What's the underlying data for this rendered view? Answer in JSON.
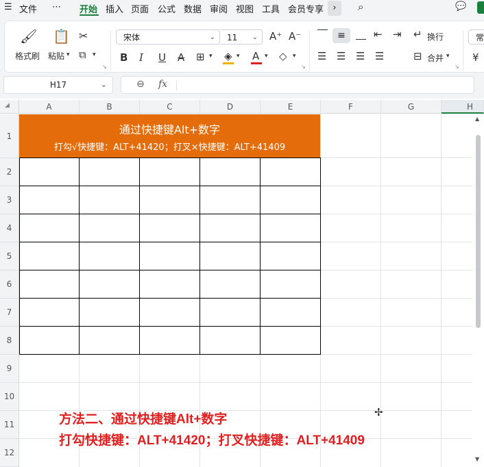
{
  "menubar": {
    "items": [
      {
        "label": "文件"
      },
      {
        "label": "⋯"
      },
      {
        "label": "开始"
      },
      {
        "label": "插入"
      },
      {
        "label": "页面"
      },
      {
        "label": "公式"
      },
      {
        "label": "数据"
      },
      {
        "label": "审阅"
      },
      {
        "label": "视图"
      },
      {
        "label": "工具"
      },
      {
        "label": "会员专享"
      }
    ],
    "active": "开始"
  },
  "ribbon": {
    "format_painter": "格式刷",
    "paste": "粘贴",
    "font_name": "宋体",
    "font_size": "11",
    "wrap": "换行",
    "merge": "合并",
    "cut_off": "常"
  },
  "formula_bar": {
    "cell_ref": "H17",
    "fx": "fx",
    "value": ""
  },
  "sheet": {
    "columns": [
      "A",
      "B",
      "C",
      "D",
      "E",
      "F",
      "G",
      "H"
    ],
    "rows": [
      "1",
      "2",
      "3",
      "4",
      "5",
      "6",
      "7",
      "8",
      "9",
      "10",
      "11",
      "12"
    ],
    "banner_title": "通过快捷键Alt+数字",
    "banner_subtitle": "打勾√快捷键：ALT+41420；打叉×快捷键：ALT+41409",
    "note_line1": "方法二、通过快捷键Alt+数字",
    "note_line2": "打勾快捷键：ALT+41420；打叉快捷键：ALT+41409"
  },
  "colors": {
    "accent": "#1a7f3c",
    "banner": "#e46c0a",
    "note": "#e02020"
  }
}
